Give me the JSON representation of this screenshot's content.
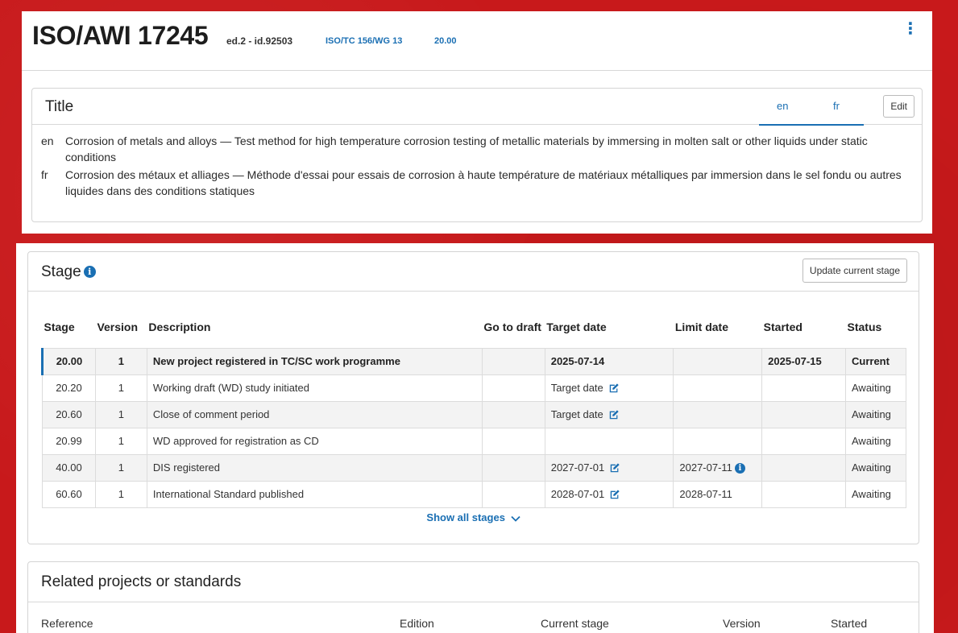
{
  "header": {
    "reference": "ISO/AWI 17245",
    "meta": "ed.2 - id.92503",
    "committee": "ISO/TC 156/WG 13",
    "stage": "20.00",
    "menu_icon": "kebab-menu-icon"
  },
  "title_section": {
    "heading": "Title",
    "tabs": [
      "en",
      "fr"
    ],
    "active_tab": "en",
    "edit_label": "Edit",
    "rows": [
      {
        "lang": "en",
        "text": "Corrosion of metals and alloys — Test method for high temperature corrosion testing of metallic materials by immersing in molten salt or other liquids under static conditions"
      },
      {
        "lang": "fr",
        "text": "Corrosion des métaux et alliages — Méthode d'essai pour essais de corrosion à haute température de matériaux métalliques par immersion dans le sel fondu ou autres liquides dans des conditions statiques"
      }
    ]
  },
  "stage_section": {
    "heading": "Stage",
    "update_label": "Update current stage",
    "columns": [
      "Stage",
      "Version",
      "Description",
      "Go to draft",
      "Target date",
      "Limit date",
      "Started",
      "Status"
    ],
    "rows": [
      {
        "stage": "20.00",
        "version": "1",
        "description": "New project registered in TC/SC work programme",
        "draft": "",
        "target": "2025-07-14",
        "limit": "",
        "started": "2025-07-15",
        "status": "Current",
        "current": true
      },
      {
        "stage": "20.20",
        "version": "1",
        "description": "Working draft (WD) study initiated",
        "draft": "",
        "target": "Target date",
        "limit": "",
        "started": "",
        "status": "Awaiting"
      },
      {
        "stage": "20.60",
        "version": "1",
        "description": "Close of comment period",
        "draft": "",
        "target": "Target date",
        "limit": "",
        "started": "",
        "status": "Awaiting"
      },
      {
        "stage": "20.99",
        "version": "1",
        "description": "WD approved for registration as CD",
        "draft": "",
        "target": "",
        "limit": "",
        "started": "",
        "status": "Awaiting"
      },
      {
        "stage": "40.00",
        "version": "1",
        "description": "DIS registered",
        "draft": "",
        "target": "2027-07-01",
        "limit": "2027-07-11",
        "started": "",
        "status": "Awaiting"
      },
      {
        "stage": "60.60",
        "version": "1",
        "description": "International Standard published",
        "draft": "",
        "target": "2028-07-01",
        "limit": "2028-07-11",
        "started": "",
        "status": "Awaiting"
      }
    ],
    "show_all_label": "Show all stages"
  },
  "related_section": {
    "heading": "Related projects or standards",
    "columns": [
      "Reference",
      "Edition",
      "Current stage",
      "Version",
      "Started"
    ]
  },
  "colors": {
    "accent": "#1a6fb3",
    "background": "#c8191b"
  }
}
